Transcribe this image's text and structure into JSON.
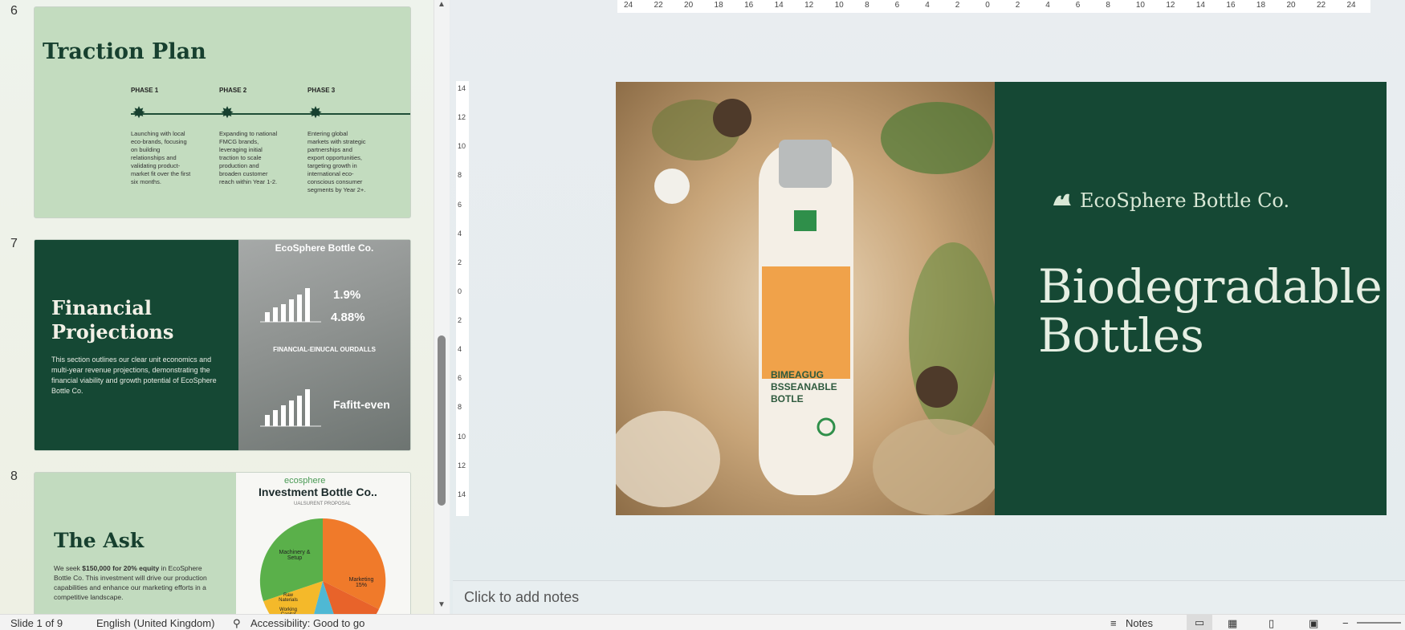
{
  "thumbnails": [
    {
      "number": "6",
      "title": "Traction Plan",
      "phases": [
        {
          "label": "PHASE 1",
          "desc": "Launching with local eco-brands, focusing on building relationships and validating product-market fit over the first six months."
        },
        {
          "label": "PHASE 2",
          "desc": "Expanding to national FMCG brands, leveraging initial traction to scale production and broaden customer reach within Year 1-2."
        },
        {
          "label": "PHASE 3",
          "desc": "Entering global markets with strategic partnerships and export opportunities, targeting growth in international eco-conscious consumer segments by Year 2+."
        }
      ]
    },
    {
      "number": "7",
      "title": "Financial Projections",
      "body": "This section outlines our clear unit economics and multi-year revenue projections, demonstrating the financial viability and growth potential of EcoSphere Bottle Co.",
      "brand": "EcoSphere Bottle Co.",
      "stat1": "1.9%",
      "stat2": "4.88%",
      "section": "FINANCIAL-EINUCAL OURDALLS",
      "breakeven": "Fafitt-even"
    },
    {
      "number": "8",
      "title": "The Ask",
      "body_prefix": "We seek ",
      "body_bold": "$150,000 for 20% equity",
      "body_suffix": " in EcoSphere Bottle Co. This investment will drive our production capabilities and enhance our marketing efforts in a competitive landscape.",
      "chart_brand": "ecosphere",
      "chart_title": "Investment Bottle Co..",
      "chart_subtitle": "UALSURENT PROPOSAL",
      "slice_machinery": "Machinery & Setup",
      "slice_marketing": "Marketing 15%",
      "slice_raw": "Raw Naterials",
      "slice_working": "Working Capital"
    }
  ],
  "current_slide": {
    "brand": "EcoSphere Bottle Co.",
    "headline_line1": "Biodegradable",
    "headline_line2": "Bottles",
    "bottle_label": "BIMEAGUG BSSEANABLE BOTLE",
    "colors": {
      "panel": "#154834",
      "text": "#e6efe3"
    }
  },
  "ruler_h": [
    "24",
    "22",
    "20",
    "18",
    "16",
    "14",
    "12",
    "10",
    "8",
    "6",
    "4",
    "2",
    "0",
    "2",
    "4",
    "6",
    "8",
    "10",
    "12",
    "14",
    "16",
    "18",
    "20",
    "22",
    "24"
  ],
  "ruler_v": [
    "14",
    "12",
    "10",
    "8",
    "6",
    "4",
    "2",
    "0",
    "2",
    "4",
    "6",
    "8",
    "10",
    "12",
    "14"
  ],
  "notes": {
    "placeholder": "Click to add notes"
  },
  "status": {
    "slide_info": "Slide 1 of 9",
    "language": "English (United Kingdom)",
    "accessibility": "Accessibility: Good to go",
    "notes_label": "Notes"
  }
}
